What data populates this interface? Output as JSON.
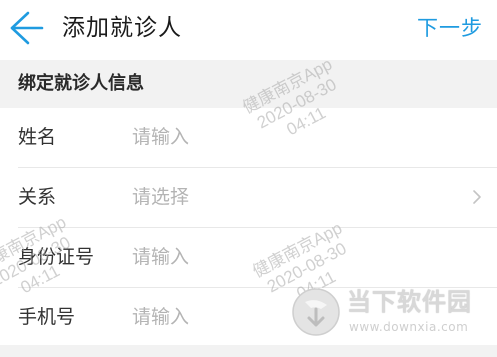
{
  "header": {
    "title": "添加就诊人",
    "next_label": "下一步"
  },
  "section": {
    "title": "绑定就诊人信息"
  },
  "form": {
    "rows": [
      {
        "label": "姓名",
        "placeholder": "请输入",
        "type": "input"
      },
      {
        "label": "关系",
        "placeholder": "请选择",
        "type": "select"
      },
      {
        "label": "身份证号",
        "placeholder": "请输入",
        "type": "input"
      },
      {
        "label": "手机号",
        "placeholder": "请输入",
        "type": "input"
      }
    ]
  },
  "watermark": {
    "app": "健康南京App",
    "date": "2020-08-30",
    "time": "04:11"
  },
  "site_logo": {
    "name": "当下软件园",
    "url": "www.downxia.com"
  },
  "colors": {
    "accent": "#1f9be0",
    "placeholder": "#b4b4b4",
    "section_bg": "#f2f2f2"
  },
  "icons": {
    "back": "arrow-left-icon",
    "chevron": "chevron-right-icon"
  }
}
